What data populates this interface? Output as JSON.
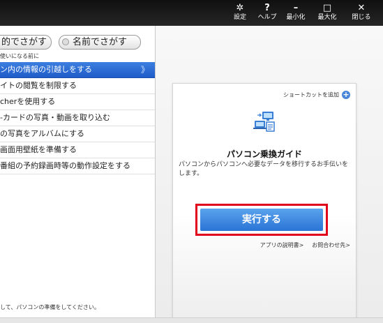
{
  "topbar": {
    "buttons": [
      {
        "icon": "gear-icon",
        "glyph": "✲",
        "label": "設定"
      },
      {
        "icon": "help-icon",
        "glyph": "?",
        "label": "ヘルプ"
      },
      {
        "icon": "minimize-icon",
        "glyph": "–",
        "label": "最小化"
      },
      {
        "icon": "maximize-icon",
        "glyph": "□",
        "label": "最大化"
      },
      {
        "icon": "close-icon",
        "glyph": "✕",
        "label": "閉じる"
      }
    ]
  },
  "left": {
    "toggle_purpose": "的でさがす",
    "toggle_name": "名前でさがす",
    "hint": "使いになる前に",
    "items": [
      {
        "label": "ン内の情報の引越しをする",
        "selected": true
      },
      {
        "label": "イトの閲覧を制限する",
        "selected": false
      },
      {
        "label": "cherを使用する",
        "selected": false
      },
      {
        "label": "-カードの写真・動画を取り込む",
        "selected": false
      },
      {
        "label": "の写真をアルバムにする",
        "selected": false
      },
      {
        "label": "画面用壁紙を準備する",
        "selected": false
      },
      {
        "label": "番組の予約録画時等の動作設定をする",
        "selected": false
      }
    ],
    "selected_arrow": "》",
    "footnote": "して、パソコンの準備をしてください。"
  },
  "card": {
    "shortcut_label": "ショートカットを追加",
    "shortcut_icon": "+",
    "title": "パソコン乗換ガイド",
    "description": "パソコンからパソコンへ必要なデータを移行するお手伝いをします。",
    "run_button": "実行する",
    "link_manual": "アプリの説明書>",
    "link_contact": "お問合わせ先>"
  },
  "colors": {
    "accent": "#2a74d6",
    "highlight_frame": "#e0001b"
  }
}
